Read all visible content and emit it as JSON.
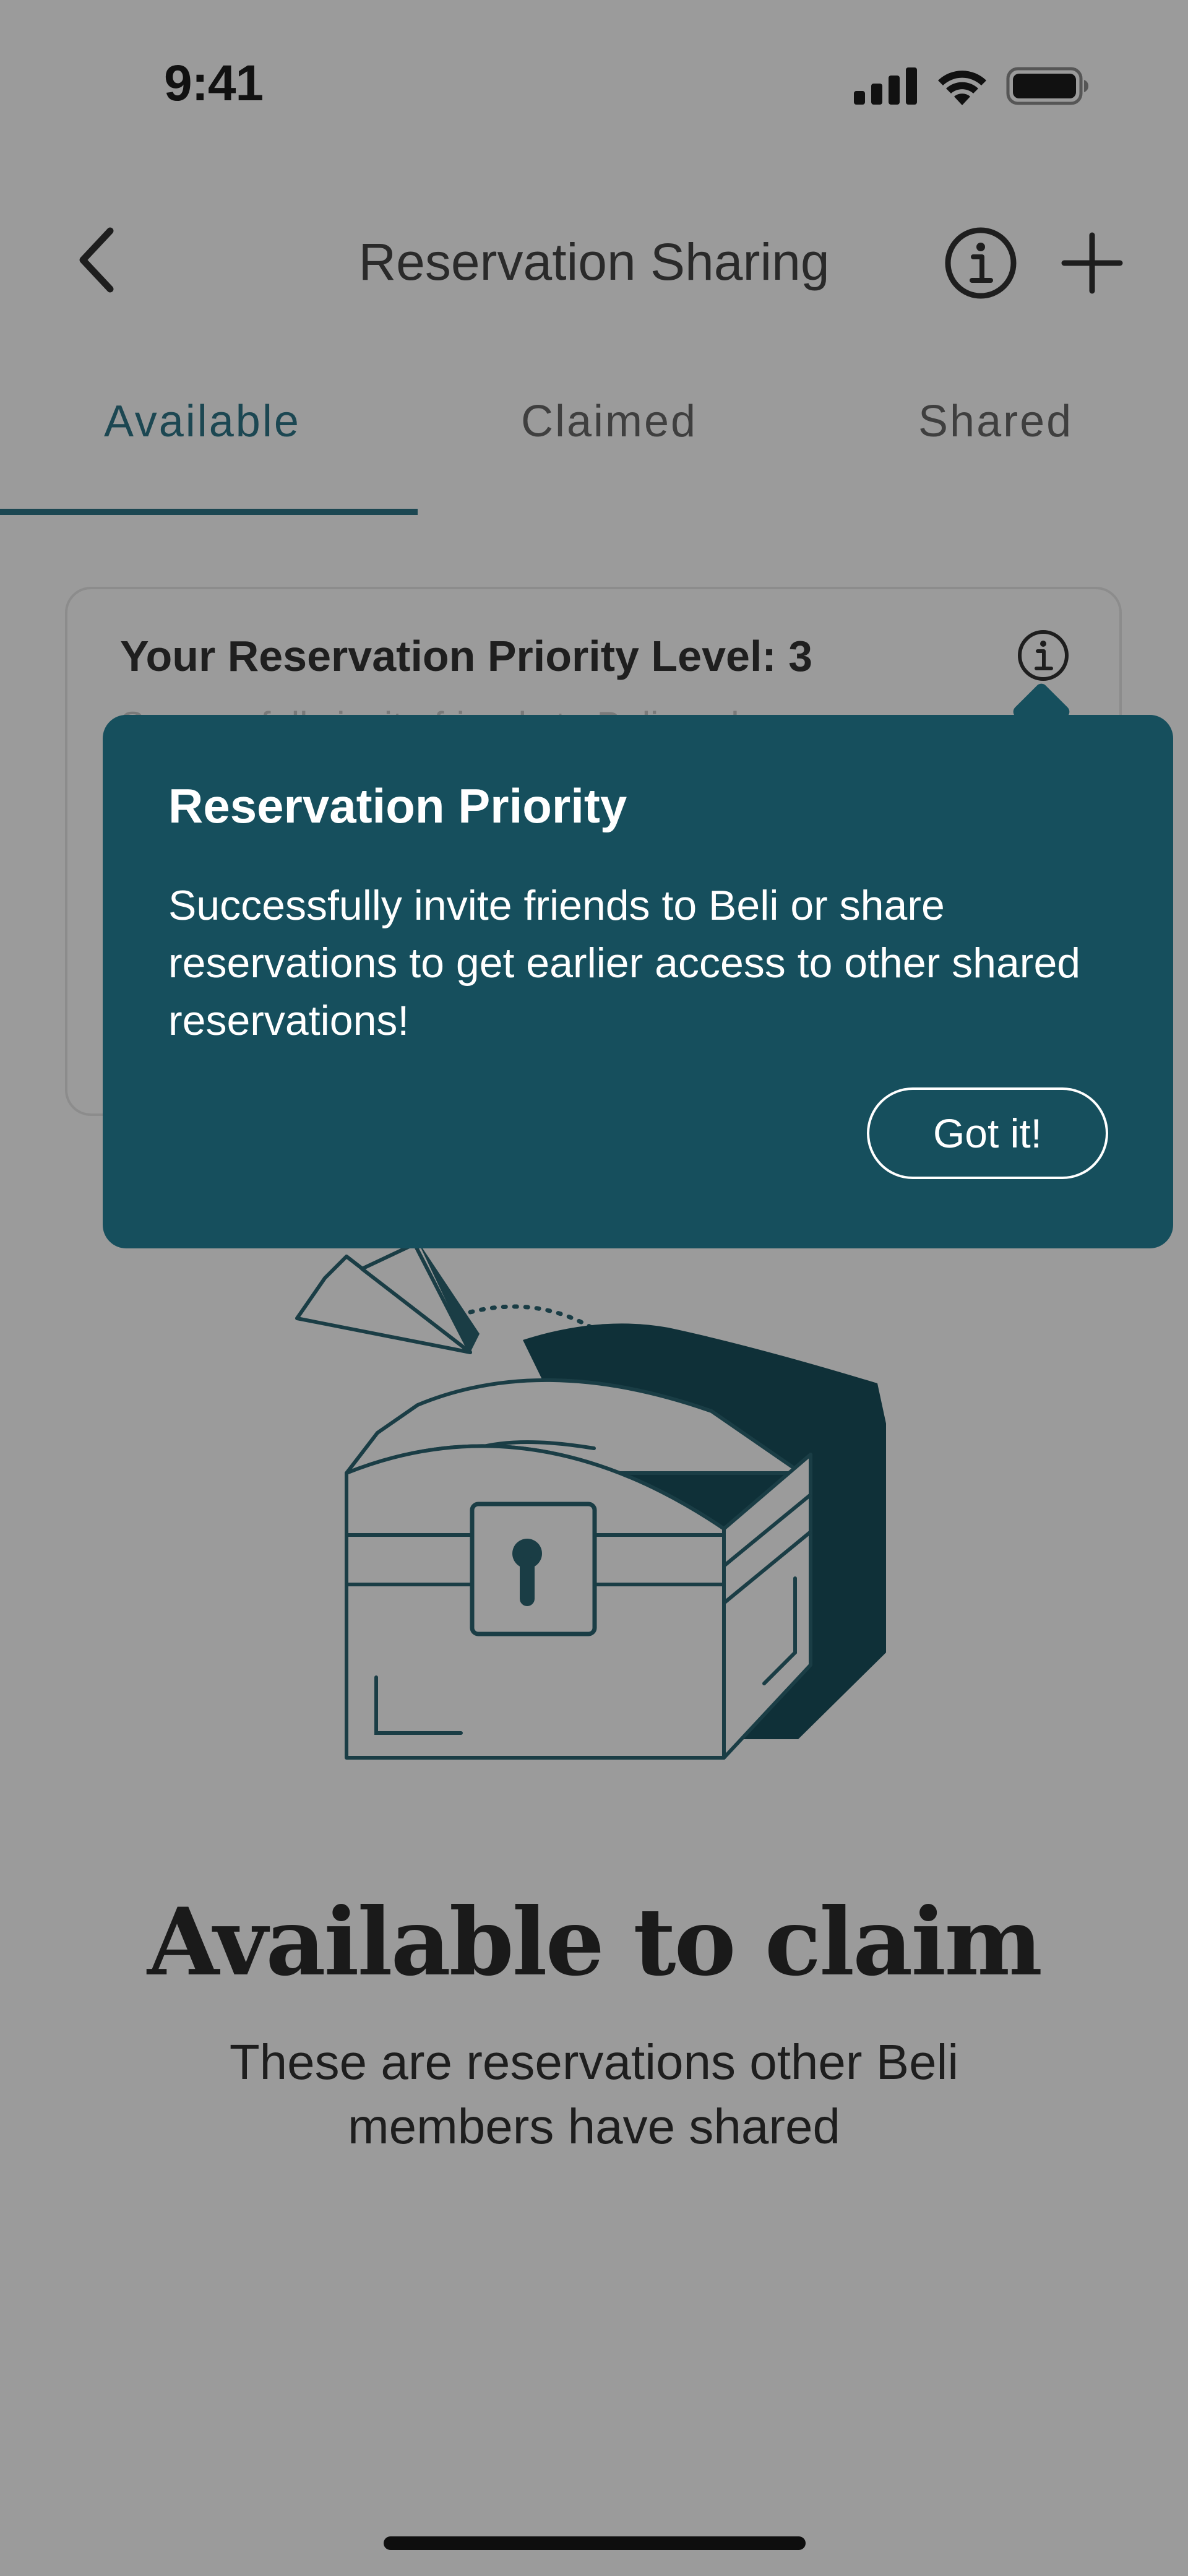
{
  "status_bar": {
    "time": "9:41",
    "icons": [
      "cellular-signal-icon",
      "wifi-icon",
      "battery-icon"
    ]
  },
  "nav": {
    "title": "Reservation Sharing",
    "back_icon": "chevron-left-icon",
    "info_icon": "info-circle-icon",
    "add_icon": "plus-icon"
  },
  "tabs": [
    {
      "label": "Available",
      "active": true
    },
    {
      "label": "Claimed",
      "active": false
    },
    {
      "label": "Shared",
      "active": false
    }
  ],
  "priority_card": {
    "title": "Your Reservation Priority Level: 3",
    "subtitle": "Successfully invite friends to Beli or share",
    "info_icon": "info-circle-icon"
  },
  "popover": {
    "title": "Reservation Priority",
    "body": "Successfully invite friends to Beli or share reservations to get earlier access to other shared reservations!",
    "button_label": "Got it!"
  },
  "empty_state": {
    "illustration": "treasure-chest-paper-plane-illustration",
    "title": "Available to claim",
    "subtitle": "These are reservations other Beli members have shared"
  },
  "colors": {
    "accent": "#164f5d",
    "overlay_background": "#9b9b9b",
    "text_dark": "#1e1e1e"
  }
}
